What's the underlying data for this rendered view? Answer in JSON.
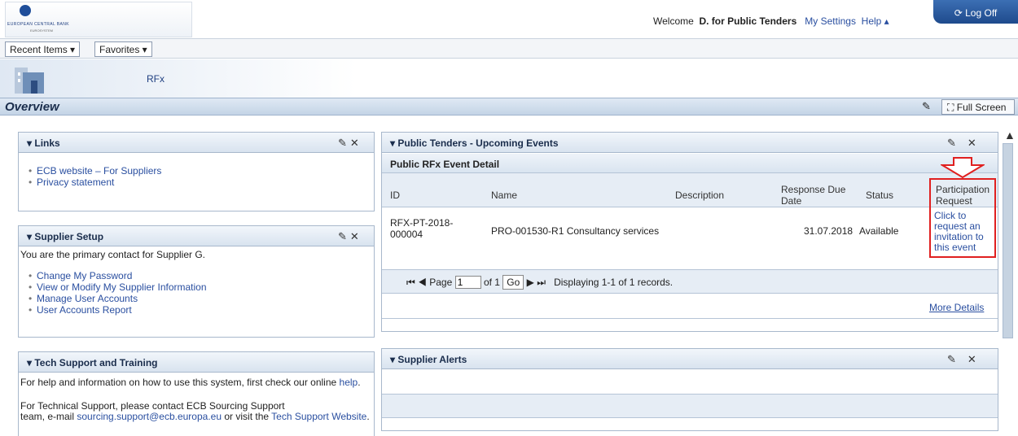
{
  "header": {
    "logo_line1": "EUROPEAN CENTRAL BANK",
    "logo_line2": "EUROSYSTEM",
    "welcome": "Welcome",
    "user": "D. for Public Tenders",
    "my_settings": "My Settings",
    "help": "Help ▴",
    "logoff": "⟳ Log Off"
  },
  "menu": {
    "recent": "Recent Items ▾",
    "favorites": "Favorites ▾"
  },
  "nav": {
    "rfx": "RFx"
  },
  "overview": {
    "title": "Overview",
    "full_screen": "Full Screen"
  },
  "links": {
    "title": "Links",
    "items": [
      "ECB website – For Suppliers",
      "Privacy statement"
    ]
  },
  "supplier_setup": {
    "title": "Supplier Setup",
    "intro": "You are the primary contact for Supplier G.",
    "items": [
      "Change My Password",
      "View or Modify My Supplier Information",
      "Manage User Accounts",
      "User Accounts Report"
    ]
  },
  "tech": {
    "title": "Tech Support and Training",
    "line1": "For help and information on how to use this system, first check our online",
    "help_link": "help",
    "line2": "For Technical Support, please contact ECB Sourcing Support",
    "line3": "team, e-mail",
    "email": "sourcing.support@ecb.europa.eu",
    "or_visit": "or visit the",
    "website": "Tech Support Website"
  },
  "tenders": {
    "title": "Public Tenders - Upcoming Events",
    "subtitle": "Public RFx Event Detail",
    "columns": {
      "id": "ID",
      "name": "Name",
      "description": "Description",
      "due": "Response Due Date",
      "status": "Status",
      "participation": "Participation Request"
    },
    "row": {
      "id": "RFX-PT-2018-000004",
      "name": "PRO-001530-R1 Consultancy services",
      "description": "",
      "due": "31.07.2018",
      "status": "Available",
      "participation": "Click to request an invitation to this event"
    },
    "pager": {
      "page": "Page",
      "page_value": "1",
      "of": "of 1",
      "go": "Go",
      "display": "Displaying 1-1 of 1 records."
    },
    "more": "More Details"
  },
  "alerts": {
    "title": "Supplier Alerts"
  },
  "colors": {
    "accent": "#2a4fa0",
    "highlight": "#e02020",
    "header_bg": "#d8e3ef"
  }
}
